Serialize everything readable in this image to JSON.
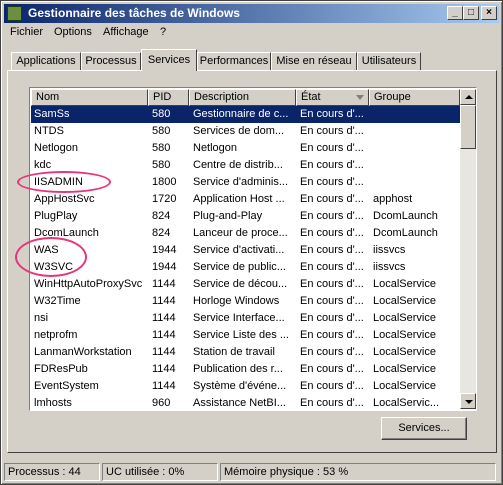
{
  "window": {
    "title": "Gestionnaire des tâches de Windows"
  },
  "title_buttons": {
    "minimize": "_",
    "maximize": "□",
    "close": "×"
  },
  "menu": [
    "Fichier",
    "Options",
    "Affichage",
    "?"
  ],
  "tabs": [
    "Applications",
    "Processus",
    "Services",
    "Performances",
    "Mise en réseau",
    "Utilisateurs"
  ],
  "active_tab": "Services",
  "columns": [
    "Nom",
    "PID",
    "Description",
    "État",
    "Groupe"
  ],
  "rows": [
    {
      "name": "SamSs",
      "pid": "580",
      "desc": "Gestionnaire de c...",
      "state": "En cours d'...",
      "group": ""
    },
    {
      "name": "NTDS",
      "pid": "580",
      "desc": "Services de dom...",
      "state": "En cours d'...",
      "group": ""
    },
    {
      "name": "Netlogon",
      "pid": "580",
      "desc": "Netlogon",
      "state": "En cours d'...",
      "group": ""
    },
    {
      "name": "kdc",
      "pid": "580",
      "desc": "Centre de distrib...",
      "state": "En cours d'...",
      "group": ""
    },
    {
      "name": "IISADMIN",
      "pid": "1800",
      "desc": "Service d'adminis...",
      "state": "En cours d'...",
      "group": ""
    },
    {
      "name": "AppHostSvc",
      "pid": "1720",
      "desc": "Application Host ...",
      "state": "En cours d'...",
      "group": "apphost"
    },
    {
      "name": "PlugPlay",
      "pid": "824",
      "desc": "Plug-and-Play",
      "state": "En cours d'...",
      "group": "DcomLaunch"
    },
    {
      "name": "DcomLaunch",
      "pid": "824",
      "desc": "Lanceur de proce...",
      "state": "En cours d'...",
      "group": "DcomLaunch"
    },
    {
      "name": "WAS",
      "pid": "1944",
      "desc": "Service d'activati...",
      "state": "En cours d'...",
      "group": "iissvcs"
    },
    {
      "name": "W3SVC",
      "pid": "1944",
      "desc": "Service de public...",
      "state": "En cours d'...",
      "group": "iissvcs"
    },
    {
      "name": "WinHttpAutoProxySvc",
      "pid": "1144",
      "desc": "Service de décou...",
      "state": "En cours d'...",
      "group": "LocalService"
    },
    {
      "name": "W32Time",
      "pid": "1144",
      "desc": "Horloge Windows",
      "state": "En cours d'...",
      "group": "LocalService"
    },
    {
      "name": "nsi",
      "pid": "1144",
      "desc": "Service Interface...",
      "state": "En cours d'...",
      "group": "LocalService"
    },
    {
      "name": "netprofm",
      "pid": "1144",
      "desc": "Service Liste des ...",
      "state": "En cours d'...",
      "group": "LocalService"
    },
    {
      "name": "LanmanWorkstation",
      "pid": "1144",
      "desc": "Station de travail",
      "state": "En cours d'...",
      "group": "LocalService"
    },
    {
      "name": "FDResPub",
      "pid": "1144",
      "desc": "Publication des r...",
      "state": "En cours d'...",
      "group": "LocalService"
    },
    {
      "name": "EventSystem",
      "pid": "1144",
      "desc": "Système d'événe...",
      "state": "En cours d'...",
      "group": "LocalService"
    },
    {
      "name": "lmhosts",
      "pid": "960",
      "desc": "Assistance NetBI...",
      "state": "En cours d'...",
      "group": "LocalServic..."
    }
  ],
  "selected_row": 0,
  "services_button": "Services...",
  "status": {
    "processes": "Processus : 44",
    "cpu": "UC utilisée : 0%",
    "memory": "Mémoire physique : 53 %"
  },
  "colors": {
    "title_start": "#0a246a",
    "title_end": "#a6caf0",
    "selection": "#0a246a",
    "annotation": "#e8347a"
  }
}
